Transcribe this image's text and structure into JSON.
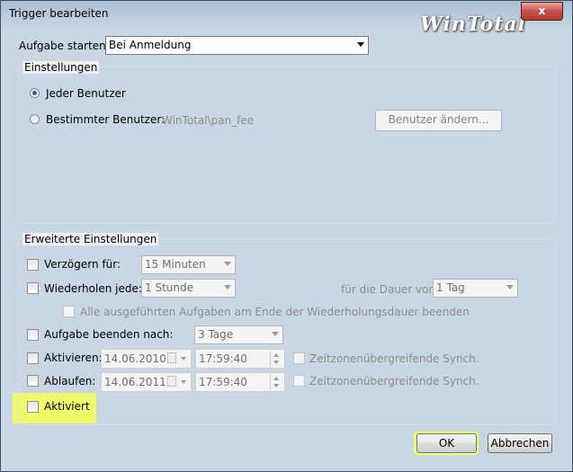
{
  "window": {
    "title": "Trigger bearbeiten",
    "close_label": "x",
    "watermark": "WinTotal"
  },
  "start_task": {
    "label": "Aufgabe starten:",
    "value": "Bei Anmeldung"
  },
  "settings": {
    "legend": "Einstellungen",
    "radio_any_user": "Jeder Benutzer",
    "radio_specific_user": "Bestimmter Benutzer:",
    "user_value": "WinTotal\\pan_fee",
    "change_user_button": "Benutzer ändern..."
  },
  "advanced": {
    "legend": "Erweiterte Einstellungen",
    "delay_label": "Verzögern für:",
    "delay_value": "15 Minuten",
    "repeat_label": "Wiederholen jede:",
    "repeat_value": "1 Stunde",
    "duration_label": "für die Dauer von:",
    "duration_value": "1 Tag",
    "stop_all_label": "Alle ausgeführten Aufgaben am Ende der Wiederholungsdauer beenden",
    "stop_after_label": "Aufgabe beenden nach:",
    "stop_after_value": "3 Tage",
    "activate_label": "Aktivieren:",
    "activate_date": "14.06.2010",
    "activate_time": "17:59:40",
    "activate_sync": "Zeitzonenübergreifende Synch.",
    "expire_label": "Ablaufen:",
    "expire_date": "14.06.2011",
    "expire_time": "17:59:40",
    "expire_sync": "Zeitzonenübergreifende Synch.",
    "enabled_label": "Aktiviert"
  },
  "buttons": {
    "ok": "OK",
    "cancel": "Abbrechen"
  },
  "colors": {
    "highlight": "#f7ff55"
  }
}
